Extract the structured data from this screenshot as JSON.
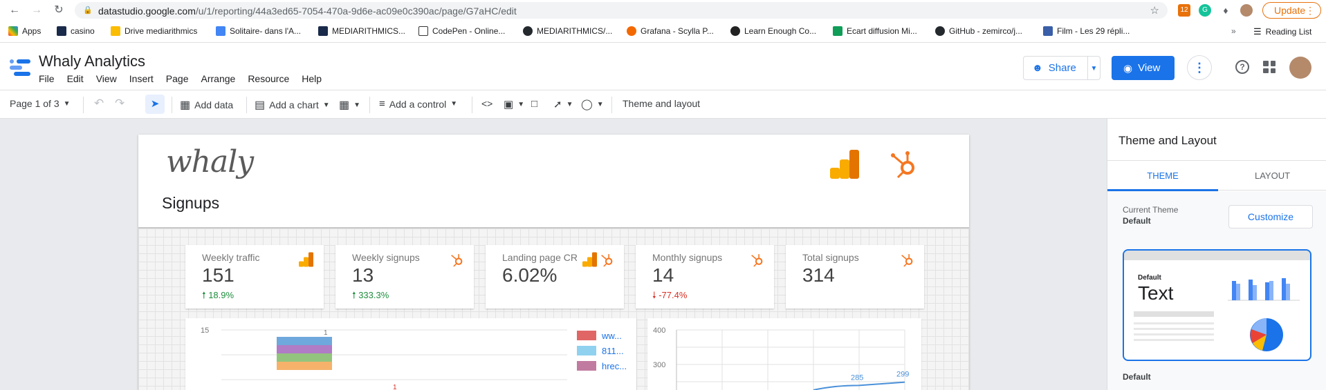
{
  "browser": {
    "url_host": "datastudio.google.com",
    "url_path": "/u/1/reporting/44a3ed65-7054-470a-9d6e-ac09e0c390ac/page/G7aHC/edit",
    "update_label": "Update",
    "extension_badge": "12",
    "bookmarks": [
      "Apps",
      "casino",
      "Drive mediarithmics",
      "Solitaire- dans l'A...",
      "MEDIARITHMICS...",
      "CodePen - Online...",
      "MEDIARITHMICS/...",
      "Grafana - Scylla P...",
      "Learn Enough Co...",
      "Ecart diffusion Mi...",
      "GitHub - zemirco/j...",
      "Film - Les 29 répli..."
    ],
    "reading_list": "Reading List"
  },
  "app": {
    "title": "Whaly Analytics",
    "menu": [
      "File",
      "Edit",
      "View",
      "Insert",
      "Page",
      "Arrange",
      "Resource",
      "Help"
    ],
    "share_label": "Share",
    "view_label": "View"
  },
  "toolbar": {
    "page_indicator": "Page 1 of 3",
    "add_data": "Add data",
    "add_chart": "Add a chart",
    "add_control": "Add a control",
    "theme_layout": "Theme and layout"
  },
  "report": {
    "logo_text": "whaly",
    "title": "Signups",
    "kpis": [
      {
        "label": "Weekly traffic",
        "value": "151",
        "delta": "18.9%",
        "direction": "up",
        "sources": [
          "ga"
        ]
      },
      {
        "label": "Weekly signups",
        "value": "13",
        "delta": "333.3%",
        "direction": "up",
        "sources": [
          "hubspot"
        ]
      },
      {
        "label": "Landing page CR",
        "value": "6.02%",
        "delta": "",
        "direction": "",
        "sources": [
          "ga",
          "hubspot"
        ]
      },
      {
        "label": "Monthly signups",
        "value": "14",
        "delta": "-77.4%",
        "direction": "down",
        "sources": [
          "hubspot"
        ]
      },
      {
        "label": "Total signups",
        "value": "314",
        "delta": "",
        "direction": "",
        "sources": [
          "hubspot"
        ]
      }
    ],
    "bar_chart": {
      "y_tick": "15",
      "bar_label_top": "1",
      "side_label": "1",
      "legend": [
        {
          "label": "ww...",
          "color": "#e06666"
        },
        {
          "label": "811...",
          "color": "#8fd1ef"
        },
        {
          "label": "hrec...",
          "color": "#c27ba0"
        }
      ],
      "stack_colors": [
        "#6fa8dc",
        "#b07cc6",
        "#93c47d",
        "#f6b26b"
      ]
    },
    "line_chart": {
      "y_ticks": [
        "400",
        "300"
      ],
      "labels": [
        "285",
        "299"
      ],
      "values": [
        285,
        299
      ],
      "y_min": 250,
      "y_max": 400,
      "color": "#4a90d9"
    }
  },
  "panel": {
    "title": "Theme and Layout",
    "tab_theme": "THEME",
    "tab_layout": "LAYOUT",
    "current_theme_label": "Current Theme",
    "current_theme_name": "Default",
    "customize": "Customize",
    "card_name": "Default",
    "card_text": "Text",
    "caption": "Default"
  }
}
